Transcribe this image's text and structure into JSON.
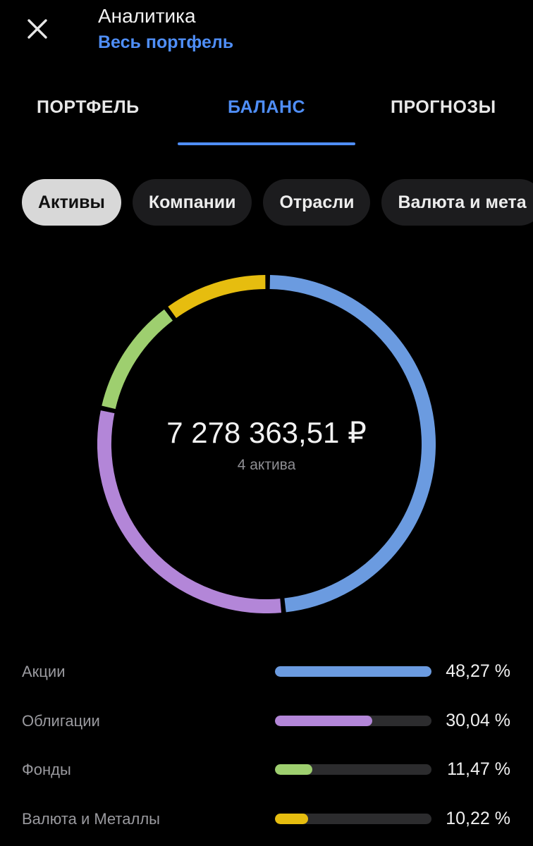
{
  "header": {
    "close_icon": "close-icon",
    "title": "Аналитика",
    "subtitle": "Весь портфель"
  },
  "tabs": [
    {
      "label": "ПОРТФЕЛЬ",
      "active": false
    },
    {
      "label": "БАЛАНС",
      "active": true
    },
    {
      "label": "ПРОГНОЗЫ",
      "active": false
    }
  ],
  "chips": [
    {
      "label": "Активы",
      "active": true
    },
    {
      "label": "Компании",
      "active": false
    },
    {
      "label": "Отрасли",
      "active": false
    },
    {
      "label": "Валюта и мета",
      "active": false
    }
  ],
  "summary": {
    "total": "7 278 363,51 ₽",
    "count": "4 актива"
  },
  "chart_data": {
    "type": "pie",
    "categories": [
      "Акции",
      "Облигации",
      "Фонды",
      "Валюта и Металлы"
    ],
    "values": [
      48.27,
      30.04,
      11.47,
      10.22
    ],
    "value_labels": [
      "48,27 %",
      "30,04 %",
      "11,47 %",
      "10,22 %"
    ],
    "colors": [
      "#6b9be0",
      "#b386d8",
      "#9ecf6f",
      "#e6bd0f"
    ]
  },
  "theme": {
    "accent": "#4f8ef7",
    "background": "#000000",
    "track": "#2c2c2e"
  }
}
